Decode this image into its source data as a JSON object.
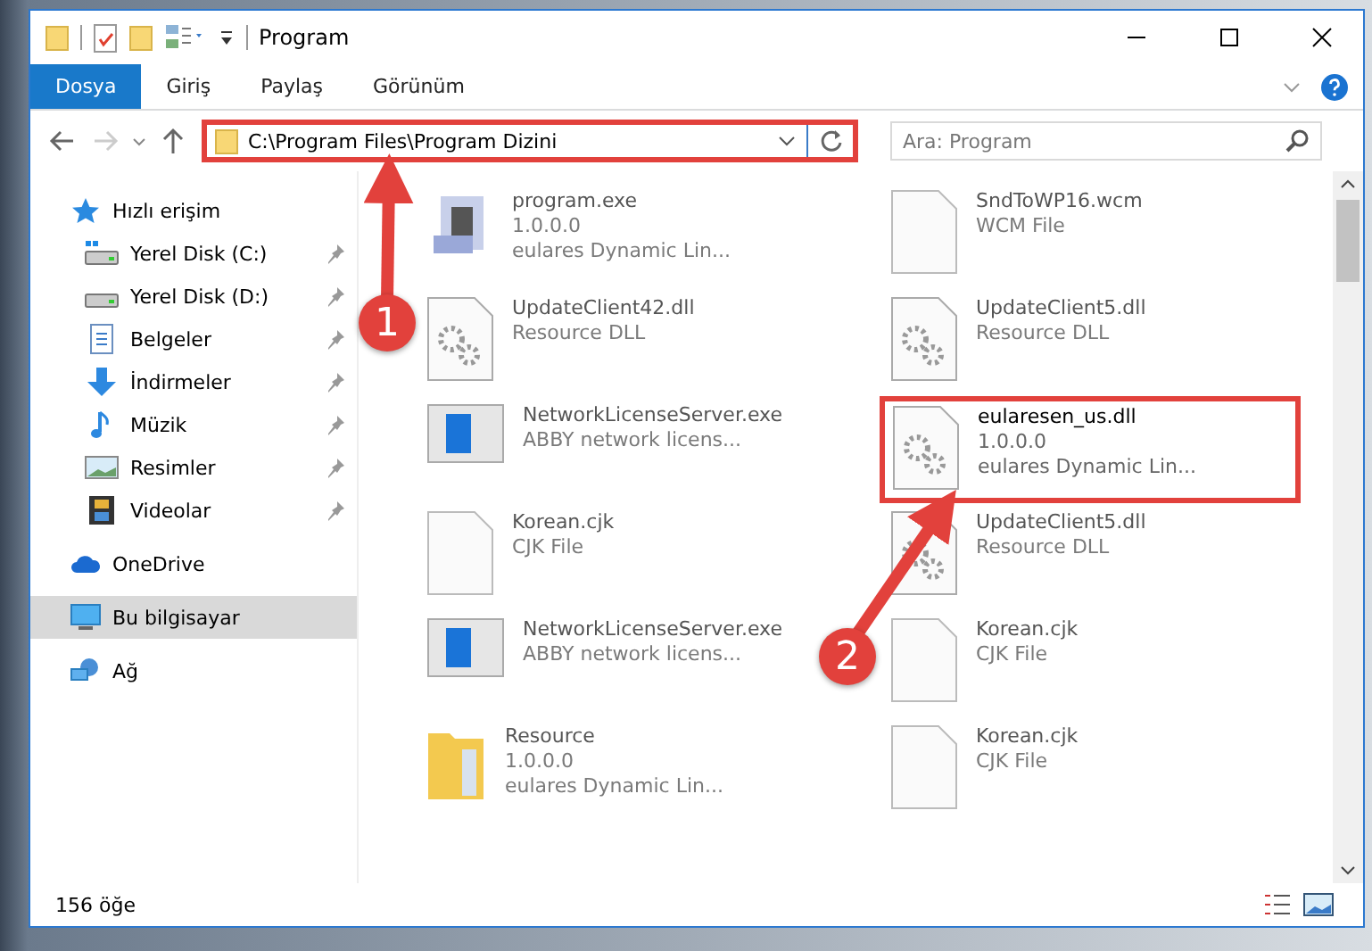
{
  "window": {
    "title": "Program"
  },
  "ribbon_tabs": [
    {
      "label": "Dosya",
      "selected": true
    },
    {
      "label": "Giriş",
      "selected": false
    },
    {
      "label": "Paylaş",
      "selected": false
    },
    {
      "label": "Görünüm",
      "selected": false
    }
  ],
  "navigation": {
    "forward_disabled": true
  },
  "address_bar": {
    "value": "C:\\Program Files\\Program Dizini",
    "highlighted": true
  },
  "search": {
    "placeholder": "Ara: Program"
  },
  "sidebar": {
    "items": [
      {
        "label": "Hızlı erişim",
        "kind": "star",
        "selected": false,
        "children": [
          {
            "label": "Yerel Disk (C:)",
            "kind": "drive-c",
            "pinned": true
          },
          {
            "label": "Yerel Disk (D:)",
            "kind": "drive",
            "pinned": true
          },
          {
            "label": "Belgeler",
            "kind": "document",
            "pinned": true
          },
          {
            "label": "İndirmeler",
            "kind": "download",
            "pinned": true
          },
          {
            "label": "Müzik",
            "kind": "music",
            "pinned": true
          },
          {
            "label": "Resimler",
            "kind": "picture",
            "pinned": true
          },
          {
            "label": "Videolar",
            "kind": "video",
            "pinned": true
          }
        ]
      },
      {
        "label": "OneDrive",
        "kind": "cloud",
        "selected": false
      },
      {
        "label": "Bu bilgisayar",
        "kind": "computer",
        "selected": true
      },
      {
        "label": "Ağ",
        "kind": "network",
        "selected": false
      }
    ]
  },
  "files": [
    {
      "name": "program.exe",
      "kind": "app",
      "highlighted": false,
      "details": [
        "1.0.0.0",
        "eulares Dynamic Lin..."
      ]
    },
    {
      "name": "SndToWP16.wcm",
      "kind": "blank",
      "highlighted": false,
      "details": [
        "WCM File"
      ]
    },
    {
      "name": "UpdateClient42.dll",
      "kind": "gear",
      "highlighted": false,
      "details": [
        "Resource DLL"
      ]
    },
    {
      "name": "UpdateClient5.dll",
      "kind": "gear",
      "highlighted": false,
      "details": [
        "Resource DLL"
      ]
    },
    {
      "name": "NetworkLicenseServer.exe",
      "kind": "window",
      "highlighted": false,
      "details": [
        "ABBY network licens..."
      ]
    },
    {
      "name": "eularesen_us.dll",
      "kind": "gear",
      "highlighted": true,
      "details": [
        "1.0.0.0",
        "eulares Dynamic Lin..."
      ]
    },
    {
      "name": "Korean.cjk",
      "kind": "blank",
      "highlighted": false,
      "details": [
        "CJK File"
      ]
    },
    {
      "name": "UpdateClient5.dll",
      "kind": "gear",
      "highlighted": false,
      "details": [
        "Resource DLL"
      ]
    },
    {
      "name": "NetworkLicenseServer.exe",
      "kind": "window",
      "highlighted": false,
      "details": [
        "ABBY network licens..."
      ]
    },
    {
      "name": "Korean.cjk",
      "kind": "blank",
      "highlighted": false,
      "details": [
        "CJK File"
      ]
    },
    {
      "name": "Resource",
      "kind": "folder",
      "highlighted": false,
      "details": [
        "1.0.0.0",
        "eulares Dynamic Lin..."
      ]
    },
    {
      "name": "Korean.cjk",
      "kind": "blank",
      "highlighted": false,
      "details": [
        "CJK File"
      ]
    }
  ],
  "status_bar": {
    "item_count": "156 öğe"
  },
  "annotations": [
    {
      "label": "1"
    },
    {
      "label": "2"
    }
  ]
}
